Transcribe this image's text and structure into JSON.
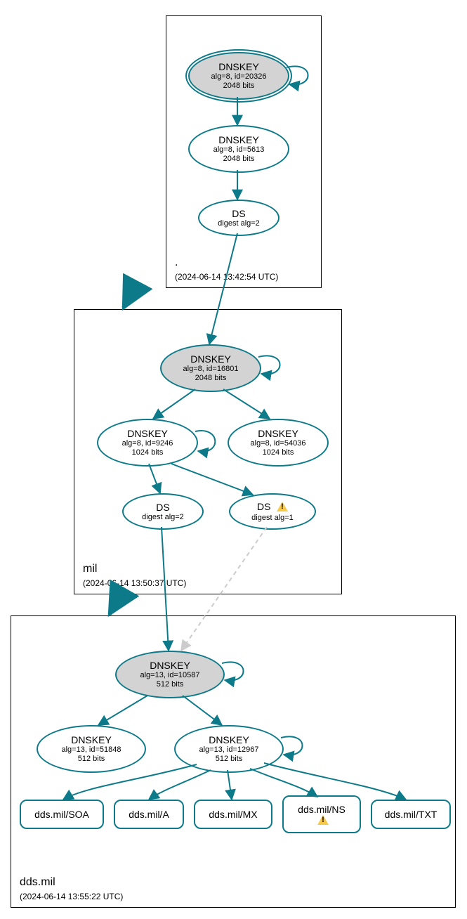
{
  "zones": {
    "root": {
      "label": ".",
      "time": "(2024-06-14 13:42:54 UTC)"
    },
    "mil": {
      "label": "mil",
      "time": "(2024-06-14 13:50:37 UTC)"
    },
    "dds": {
      "label": "dds.mil",
      "time": "(2024-06-14 13:55:22 UTC)"
    }
  },
  "nodes": {
    "root_ksk": {
      "t": "DNSKEY",
      "s1": "alg=8, id=20326",
      "s2": "2048 bits"
    },
    "root_zsk": {
      "t": "DNSKEY",
      "s1": "alg=8, id=5613",
      "s2": "2048 bits"
    },
    "root_ds": {
      "t": "DS",
      "s1": "digest alg=2"
    },
    "mil_ksk": {
      "t": "DNSKEY",
      "s1": "alg=8, id=16801",
      "s2": "2048 bits"
    },
    "mil_zsk1": {
      "t": "DNSKEY",
      "s1": "alg=8, id=9246",
      "s2": "1024 bits"
    },
    "mil_zsk2": {
      "t": "DNSKEY",
      "s1": "alg=8, id=54036",
      "s2": "1024 bits"
    },
    "mil_ds1": {
      "t": "DS",
      "s1": "digest alg=2"
    },
    "mil_ds2": {
      "t": "DS",
      "s1": "digest alg=1"
    },
    "dds_ksk": {
      "t": "DNSKEY",
      "s1": "alg=13, id=10587",
      "s2": "512 bits"
    },
    "dds_zsk1": {
      "t": "DNSKEY",
      "s1": "alg=13, id=51848",
      "s2": "512 bits"
    },
    "dds_zsk2": {
      "t": "DNSKEY",
      "s1": "alg=13, id=12967",
      "s2": "512 bits"
    },
    "rr_soa": {
      "t": "dds.mil/SOA"
    },
    "rr_a": {
      "t": "dds.mil/A"
    },
    "rr_mx": {
      "t": "dds.mil/MX"
    },
    "rr_ns": {
      "t": "dds.mil/NS"
    },
    "rr_txt": {
      "t": "dds.mil/TXT"
    }
  }
}
